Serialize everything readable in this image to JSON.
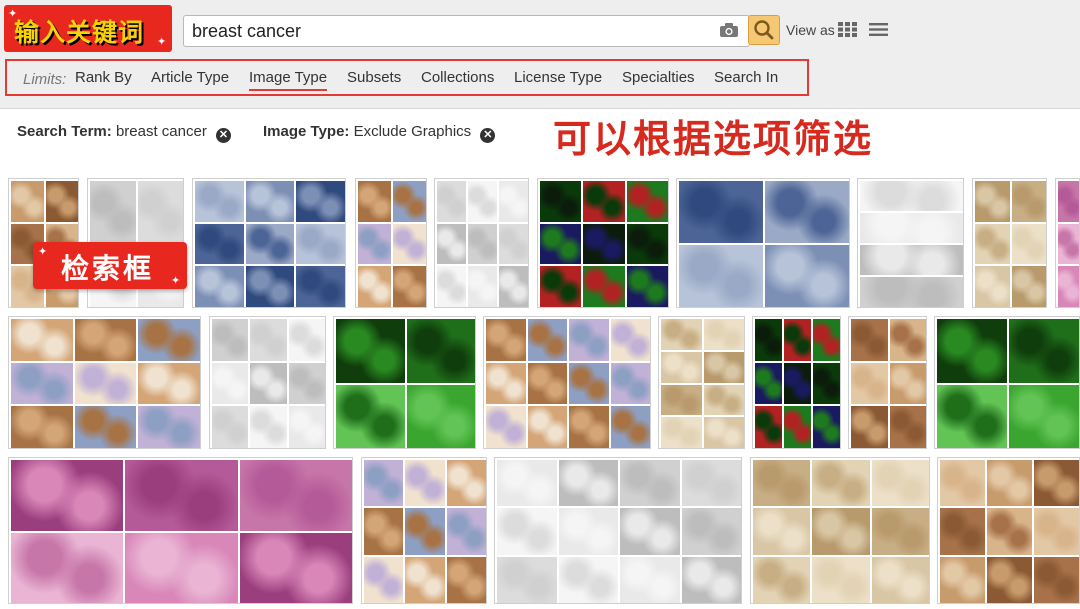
{
  "logo": {
    "text": "输入关键词"
  },
  "search": {
    "value": "breast cancer"
  },
  "view": {
    "label": "View as"
  },
  "limits": {
    "label": "Limits:",
    "tabs": [
      "Rank By",
      "Article Type",
      "Image Type",
      "Subsets",
      "Collections",
      "License Type",
      "Specialties",
      "Search In"
    ],
    "active_tab": "Image Type"
  },
  "filters": {
    "term_label": "Search Term:",
    "term_value": "breast cancer",
    "type_label": "Image Type:",
    "type_value": "Exclude Graphics"
  },
  "annotations": {
    "filter_note": "可以根据选项筛选",
    "search_note": "检索框"
  },
  "results": {
    "row1": [
      "ihc-brown-grid",
      "ihc-light",
      "he-blue-grid",
      "ihc-mixed",
      "diagram-grid",
      "fluorescence-green",
      "ihc-blue-brown",
      "gel-bands",
      "ihc-tma",
      "ihc-purple-partial"
    ],
    "row2": [
      "ihc-bar-km",
      "tma-pie",
      "fluorescence-large",
      "he-ihc-mix",
      "tma-circles",
      "western-fluor",
      "ihc-tan",
      "fluorescence-green-2"
    ],
    "row3": [
      "he-pink-brown",
      "ihc-boxplot",
      "flow-western",
      "ihc-barchart",
      "ihc-he-strip"
    ]
  },
  "colors": {
    "accent_red": "#e53935",
    "logo_yellow": "#f5d20c",
    "search_button": "#f7c873"
  }
}
